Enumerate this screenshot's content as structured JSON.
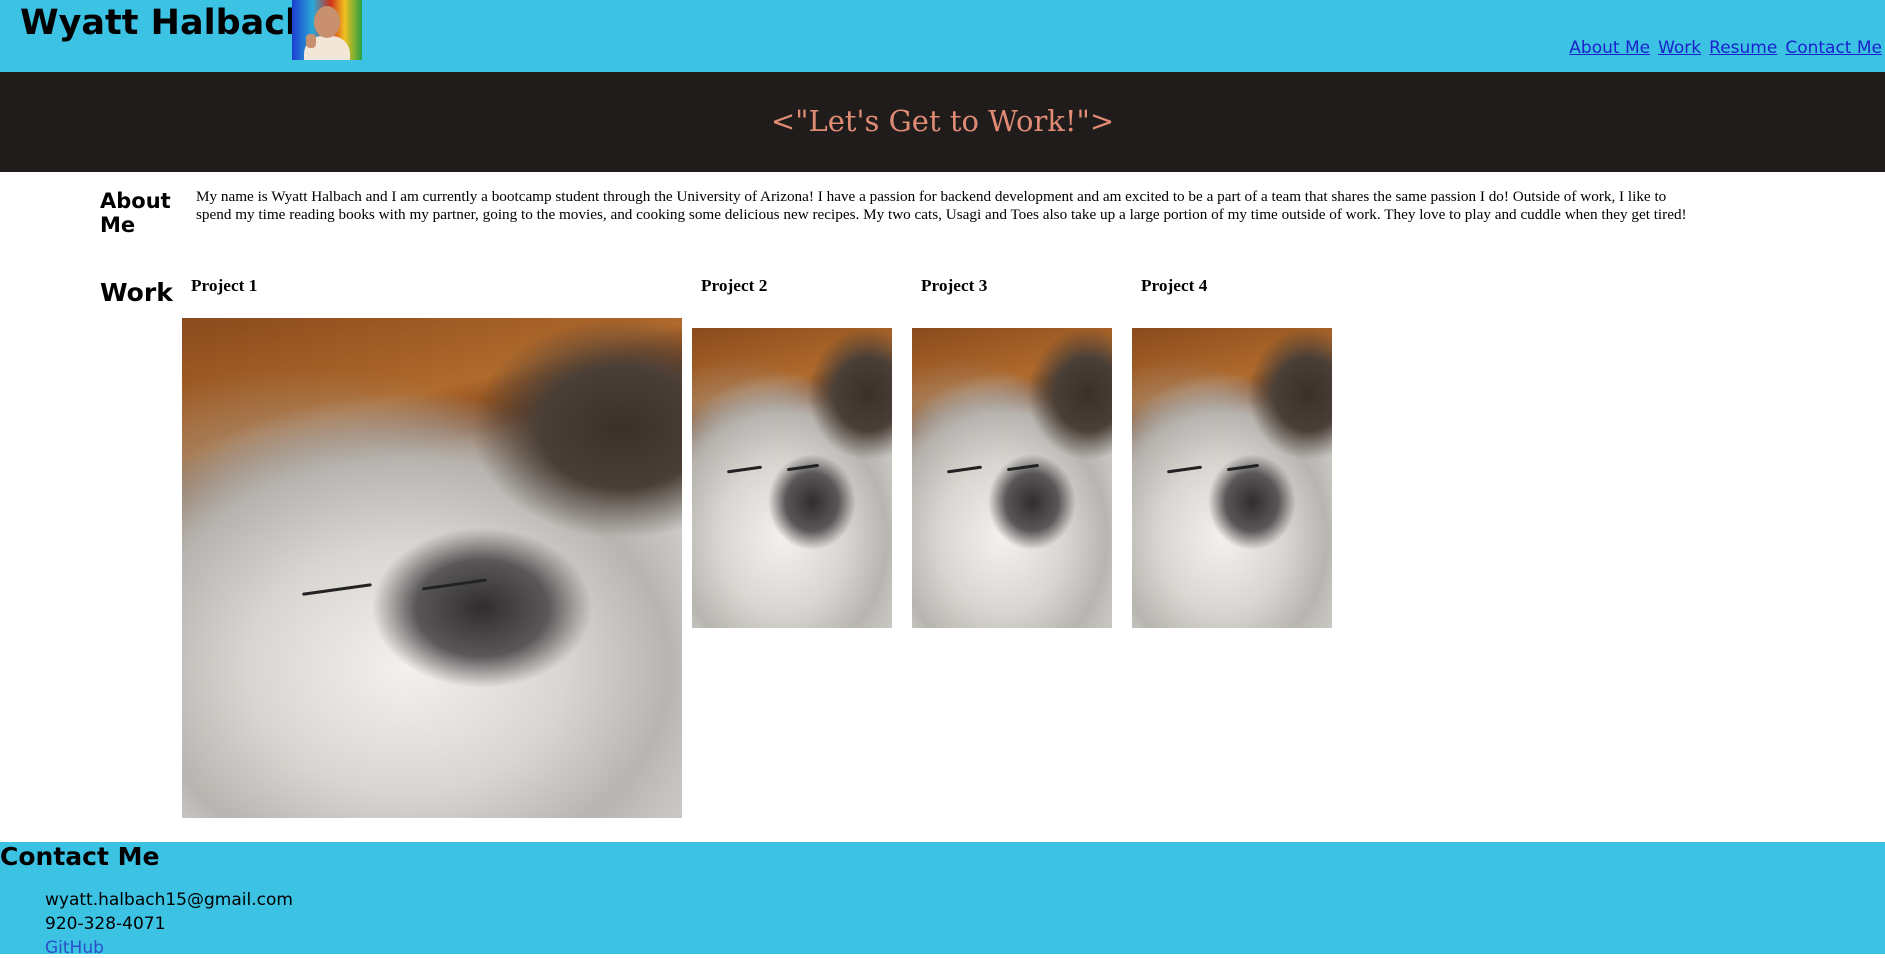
{
  "colors": {
    "brand": "#3cc3e4",
    "hero_bg": "#211c1c",
    "hero_text": "#e08b73",
    "link": "#1a22cc"
  },
  "header": {
    "title": "Wyatt Halbach",
    "nav": {
      "about": "About Me",
      "work": "Work",
      "resume": "Resume",
      "contact": "Contact Me"
    }
  },
  "hero": {
    "text": "<\"Let's Get to Work!\">"
  },
  "about": {
    "heading": "About Me",
    "text": "My name is Wyatt Halbach and I am currently a bootcamp student through the University of Arizona! I have a passion for backend development and am excited to be a part of a team that shares the same passion I do! Outside of work, I like to spend my time reading books with my partner, going to the movies, and cooking some delicious new recipes. My two cats, Usagi and Toes also take up a large portion of my time outside of work. They love to play and cuddle when they get tired!"
  },
  "work": {
    "heading": "Work",
    "projects": [
      {
        "title": "Project 1"
      },
      {
        "title": "Project 2"
      },
      {
        "title": "Project 3"
      },
      {
        "title": "Project 4"
      }
    ]
  },
  "footer": {
    "heading": "Contact Me",
    "email": "wyatt.halbach15@gmail.com",
    "phone": "920-328-4071",
    "github": "GitHub"
  }
}
